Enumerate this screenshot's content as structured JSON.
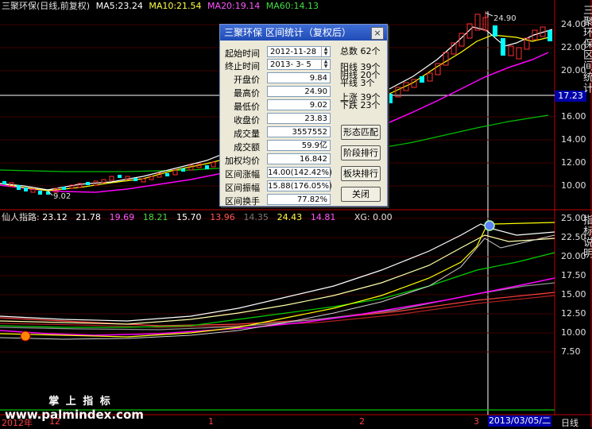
{
  "top_header": {
    "title": "三聚环保(日线,前复权)",
    "ma5_label": "MA5:",
    "ma5_value": "23.24",
    "ma10_label": "MA10:",
    "ma10_value": "21.54",
    "ma20_label": "MA20:",
    "ma20_value": "19.14",
    "ma60_label": "MA60:",
    "ma60_value": "14.13"
  },
  "top_yaxis": [
    "24.00",
    "22.00",
    "20.00",
    "16.00",
    "14.00",
    "12.00",
    "10.00"
  ],
  "price_marker": "17.23",
  "high_annotation": "24.90",
  "low_annotation": "9.02",
  "top_side_text": "三聚环保区间统计",
  "dialog": {
    "title": "三聚环保  区间统计（复权后）",
    "close": "×",
    "start_label": "起始时间",
    "start_value": "2012-11-28",
    "end_label": "终止时间",
    "end_value": "2013- 3- 5",
    "rows": [
      {
        "label": "开盘价",
        "value": "9.84"
      },
      {
        "label": "最高价",
        "value": "24.90"
      },
      {
        "label": "最低价",
        "value": "9.02"
      },
      {
        "label": "收盘价",
        "value": "23.83"
      },
      {
        "label": "成交量",
        "value": "3557552"
      },
      {
        "label": "成交额",
        "value": "59.9亿"
      },
      {
        "label": "加权均价",
        "value": "16.842"
      },
      {
        "label": "区间涨幅",
        "value": "14.00(142.42%)"
      },
      {
        "label": "区间振幅",
        "value": "15.88(176.05%)"
      },
      {
        "label": "区间换手",
        "value": "77.82%"
      }
    ],
    "total_label": "总数",
    "total_value": "62个",
    "yang_label": "阳线",
    "yang_value": "39个",
    "yin_label": "阴线",
    "yin_value": "20个",
    "ping_label": "平线",
    "ping_value": "3个",
    "up_label": "上涨",
    "up_value": "39个",
    "down_label": "下跌",
    "down_value": "23个",
    "buttons": [
      "形态匹配",
      "阶段排行",
      "板块排行",
      "关闭"
    ]
  },
  "bottom_header": {
    "name": "仙人指路",
    "values": [
      {
        "text": "23.12",
        "color": "#ffffff"
      },
      {
        "text": "21.78",
        "color": "#ffffff"
      },
      {
        "text": "19.69",
        "color": "#ff55ff"
      },
      {
        "text": "18.21",
        "color": "#44dd44"
      },
      {
        "text": "15.70",
        "color": "#ffffff"
      },
      {
        "text": "13.96",
        "color": "#ff5555"
      },
      {
        "text": "14.35",
        "color": "#777777"
      },
      {
        "text": "24.43",
        "color": "#ffff44"
      },
      {
        "text": "14.81",
        "color": "#ff55ff"
      }
    ],
    "xg_label": "XG:",
    "xg_value": "0.00"
  },
  "bottom_yaxis": [
    "25.00",
    "22.50",
    "20.00",
    "17.50",
    "15.00",
    "12.50",
    "10.00",
    "7.50"
  ],
  "bottom_side_text": "指标说明",
  "x_axis": {
    "start": "2012年",
    "labels": [
      "12",
      "1",
      "2",
      "3"
    ],
    "cursor_date": "2013/03/05/二",
    "period": "日线"
  },
  "watermark": {
    "line1": "掌 上 指 标",
    "line2": "www.palmindex.com"
  },
  "colors": {
    "axis_red": "#c00000",
    "cyan": "#00ffff",
    "ma_white": "#ffffff",
    "ma_yellow": "#ffff00",
    "ma_magenta": "#ff00ff",
    "ma_green": "#00c000"
  }
}
